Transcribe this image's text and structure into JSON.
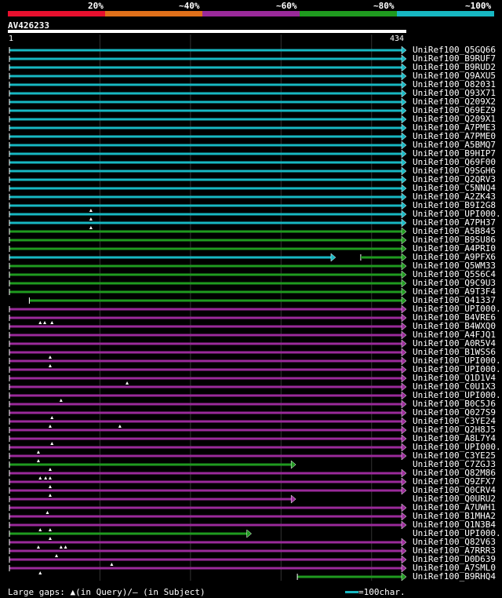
{
  "scale_labels": [
    "20%",
    "~40%",
    "~60%",
    "~80%",
    "~100%"
  ],
  "scale_colors": [
    "#e8102e",
    "#e0701a",
    "#9a2a9a",
    "#1f9a1f",
    "#17b7c2"
  ],
  "query": {
    "name": "AV426233",
    "start_label": "1",
    "end_label": "434"
  },
  "footer": {
    "gaps_label": "Large gaps: ▲(in Query)/— (in Subject)",
    "scale_label": "=100char."
  },
  "hits": [
    {
      "name": "UniRef100_Q5GQ66",
      "color": "cyan",
      "end": 434
    },
    {
      "name": "UniRef100_B9RUF7",
      "color": "cyan",
      "end": 434
    },
    {
      "name": "UniRef100_B9RUD2",
      "color": "cyan",
      "end": 434
    },
    {
      "name": "UniRef100_Q9AXU5",
      "color": "cyan",
      "end": 434
    },
    {
      "name": "UniRef100_O82031",
      "color": "cyan",
      "end": 434
    },
    {
      "name": "UniRef100_Q93X71",
      "color": "cyan",
      "end": 434
    },
    {
      "name": "UniRef100_Q209X2",
      "color": "cyan",
      "end": 434
    },
    {
      "name": "UniRef100_Q69EZ9",
      "color": "cyan",
      "end": 434
    },
    {
      "name": "UniRef100_Q209X1",
      "color": "cyan",
      "end": 434
    },
    {
      "name": "UniRef100_A7PME3",
      "color": "cyan",
      "end": 434
    },
    {
      "name": "UniRef100_A7PME0",
      "color": "cyan",
      "end": 434
    },
    {
      "name": "UniRef100_A5BMQ7",
      "color": "cyan",
      "end": 434
    },
    {
      "name": "UniRef100_B9HIP7",
      "color": "cyan",
      "end": 434
    },
    {
      "name": "UniRef100_Q69F00",
      "color": "cyan",
      "end": 434
    },
    {
      "name": "UniRef100_Q9SGH6",
      "color": "cyan",
      "end": 434
    },
    {
      "name": "UniRef100_Q2QRV3",
      "color": "cyan",
      "end": 434
    },
    {
      "name": "UniRef100_C5NNQ4",
      "color": "cyan",
      "end": 434
    },
    {
      "name": "UniRef100_A2ZK43",
      "color": "cyan",
      "end": 434
    },
    {
      "name": "UniRef100_B9I2G8",
      "color": "cyan",
      "end": 434
    },
    {
      "name": "UniRef100_UPI000..",
      "color": "cyan",
      "end": 434,
      "marks": [
        90
      ]
    },
    {
      "name": "UniRef100_A7PH37",
      "color": "cyan",
      "end": 434,
      "marks": [
        90
      ]
    },
    {
      "name": "UniRef100_A5B845",
      "color": "green",
      "end": 434,
      "marks": [
        90
      ]
    },
    {
      "name": "UniRef100_B9SU86",
      "color": "green",
      "end": 434
    },
    {
      "name": "UniRef100_A4PRI0",
      "color": "green",
      "end": 434
    },
    {
      "name": "UniRef100_A9PFX6",
      "color": "cyan",
      "end": 356,
      "tail": [
        388,
        434
      ]
    },
    {
      "name": "UniRef100_Q5WM33",
      "color": "green",
      "end": 434
    },
    {
      "name": "UniRef100_Q5S6C4",
      "color": "green",
      "end": 434
    },
    {
      "name": "UniRef100_Q9C9U3",
      "color": "green",
      "end": 434
    },
    {
      "name": "UniRef100_A9T3F4",
      "color": "green",
      "end": 434
    },
    {
      "name": "UniRef100_Q41337",
      "color": "green",
      "start": 22,
      "end": 434
    },
    {
      "name": "UniRef100_UPI000..",
      "color": "purple",
      "end": 434
    },
    {
      "name": "UniRef100_B4VRE6",
      "color": "purple",
      "end": 434
    },
    {
      "name": "UniRef100_B4WXQ0",
      "color": "purple",
      "end": 434,
      "marks": [
        34,
        39,
        47
      ]
    },
    {
      "name": "UniRef100_A4FJQ1",
      "color": "purple",
      "end": 434
    },
    {
      "name": "UniRef100_A0R5V4",
      "color": "purple",
      "end": 434
    },
    {
      "name": "UniRef100_B1WSS6",
      "color": "purple",
      "end": 434
    },
    {
      "name": "UniRef100_UPI000..",
      "color": "purple",
      "end": 434,
      "marks": [
        45
      ]
    },
    {
      "name": "UniRef100_UPI000..",
      "color": "purple",
      "end": 434,
      "marks": [
        45
      ]
    },
    {
      "name": "UniRef100_Q1D1V4",
      "color": "purple",
      "end": 434
    },
    {
      "name": "UniRef100_C0U1X3",
      "color": "purple",
      "end": 434,
      "marks": [
        130
      ]
    },
    {
      "name": "UniRef100_UPI000..",
      "color": "purple",
      "end": 434
    },
    {
      "name": "UniRef100_B0C5J6",
      "color": "purple",
      "end": 434,
      "marks": [
        57
      ]
    },
    {
      "name": "UniRef100_Q027S9",
      "color": "purple",
      "end": 434
    },
    {
      "name": "UniRef100_C3YE24",
      "color": "purple",
      "end": 434,
      "marks": [
        47
      ]
    },
    {
      "name": "UniRef100_Q2H8J5",
      "color": "purple",
      "end": 434,
      "marks": [
        45,
        122
      ]
    },
    {
      "name": "UniRef100_A8L7Y4",
      "color": "purple",
      "end": 434
    },
    {
      "name": "UniRef100_UPI000..",
      "color": "purple",
      "end": 434,
      "marks": [
        47
      ]
    },
    {
      "name": "UniRef100_C3YE25",
      "color": "purple",
      "end": 434,
      "marks": [
        32
      ]
    },
    {
      "name": "UniRef100_C7ZGJ3",
      "color": "green",
      "end": 312,
      "marks": [
        32
      ]
    },
    {
      "name": "UniRef100_Q82M86",
      "color": "purple",
      "end": 434,
      "marks": [
        45
      ]
    },
    {
      "name": "UniRef100_Q9ZFX7",
      "color": "purple",
      "end": 434,
      "marks": [
        34,
        40,
        45
      ]
    },
    {
      "name": "UniRef100_Q0CRV4",
      "color": "purple",
      "end": 434,
      "marks": [
        45
      ]
    },
    {
      "name": "UniRef100_Q0URU2",
      "color": "purple",
      "end": 312,
      "marks": [
        45
      ]
    },
    {
      "name": "UniRef100_A7UWH1",
      "color": "purple",
      "end": 434
    },
    {
      "name": "UniRef100_B1MHA2",
      "color": "purple",
      "end": 434,
      "marks": [
        42
      ]
    },
    {
      "name": "UniRef100_Q1N3B4",
      "color": "purple",
      "end": 434
    },
    {
      "name": "UniRef100_UPI000..",
      "color": "green",
      "end": 263,
      "marks": [
        34,
        45
      ]
    },
    {
      "name": "UniRef100_Q82V63",
      "color": "purple",
      "end": 434,
      "marks": [
        45
      ]
    },
    {
      "name": "UniRef100_A7RRR3",
      "color": "purple",
      "end": 434,
      "marks": [
        32,
        57,
        62
      ]
    },
    {
      "name": "UniRef100_D0D639",
      "color": "purple",
      "end": 434,
      "marks": [
        52
      ]
    },
    {
      "name": "UniRef100_A7SML0",
      "color": "purple",
      "end": 434,
      "marks": [
        113
      ]
    },
    {
      "name": "UniRef100_B9RHQ4",
      "color": "green",
      "start": 318,
      "end": 434,
      "marks": [
        34
      ]
    }
  ]
}
